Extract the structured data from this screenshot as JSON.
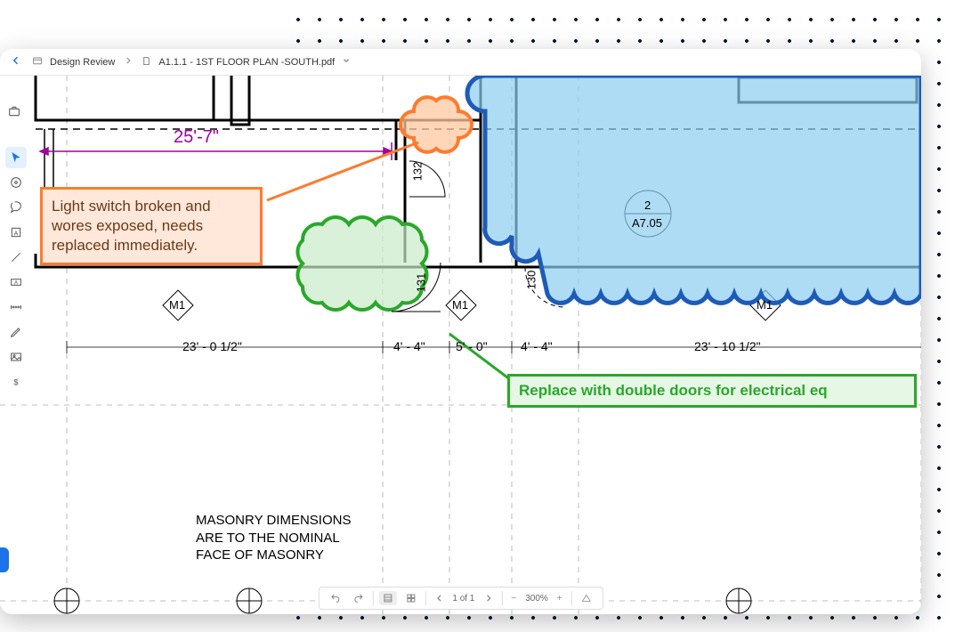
{
  "breadcrumb": {
    "root": "Design Review",
    "file": "A1.1.1 - 1ST FLOOR PLAN -SOUTH.pdf"
  },
  "annotations": {
    "orange_text": "Light switch broken and wores exposed, needs replaced immediately.",
    "green_text": "Replace with double doors for electrical eq"
  },
  "dimensions": {
    "main_purple": "25'-7\"",
    "d1": "23' - 0 1/2\"",
    "d2": "4' - 4\"",
    "d3": "5' - 0\"",
    "d4": "4' - 4\"",
    "d5": "23' - 10 1/2\"",
    "door1": "132",
    "door2": "131",
    "door3": "130"
  },
  "markers": {
    "m1": "M1",
    "detail_num": "2",
    "detail_sheet": "A7.05"
  },
  "notes": {
    "masonry": "MASONRY DIMENSIONS\nARE TO THE NOMINAL\nFACE OF MASONRY"
  },
  "footer": {
    "page": "1 of 1",
    "zoom": "300%"
  },
  "tools": {
    "briefcase": "briefcase",
    "pointer": "pointer",
    "pan": "pan",
    "lasso": "lasso",
    "text": "text",
    "line": "line",
    "textbox": "textbox",
    "measure": "measure",
    "pencil": "pencil",
    "image": "image",
    "dollar": "dollar"
  },
  "colors": {
    "orange": "#ff7a2e",
    "green": "#2aa82a",
    "blue_cloud": "#1e5bb8",
    "blue_fill": "#8bcdf0",
    "purple": "#a000a0"
  }
}
